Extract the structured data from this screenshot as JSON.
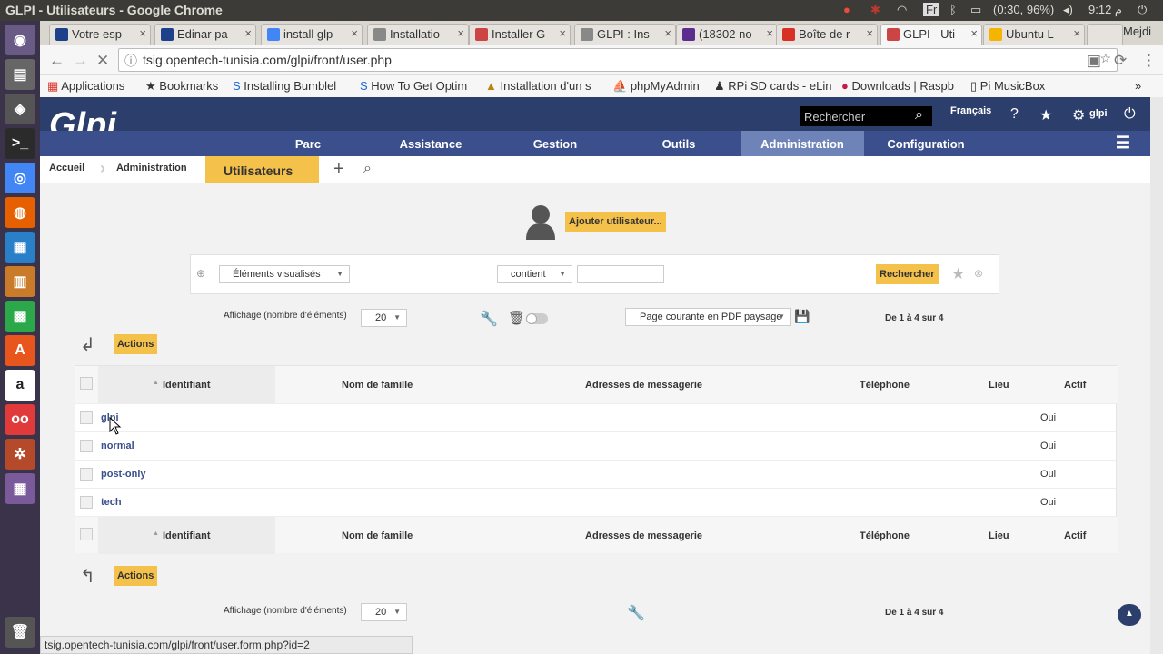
{
  "window": {
    "title": "GLPI - Utilisateurs - Google Chrome",
    "battery": "(0:30, 96%)",
    "lang": "Fr",
    "time": "9:12 م",
    "user": "Mejdi"
  },
  "tabs": [
    {
      "label": "Votre esp",
      "color": "#1e3f8a"
    },
    {
      "label": "Edinar pa",
      "color": "#1e3f8a"
    },
    {
      "label": "install glp",
      "color": "#4285f4"
    },
    {
      "label": "Installatio",
      "color": "#888888"
    },
    {
      "label": "Installer G",
      "color": "#cc4444"
    },
    {
      "label": "GLPI : Ins",
      "color": "#888888"
    },
    {
      "label": "(18302 no",
      "color": "#5b2d8e"
    },
    {
      "label": "Boîte de r",
      "color": "#d93025"
    },
    {
      "label": "GLPI - Uti",
      "color": "#cc4444"
    },
    {
      "label": "Ubuntu L",
      "color": "#f4b400"
    }
  ],
  "url": "tsig.opentech-tunisia.com/glpi/front/user.php",
  "bookmarks": [
    "Applications",
    "Bookmarks",
    "Installing Bumblel",
    "How To Get Optim",
    "Installation d'un s",
    "phpMyAdmin",
    "RPi SD cards - eLin",
    "Downloads | Raspb",
    "Pi MusicBox"
  ],
  "header": {
    "logo": "Glpi",
    "search_placeholder": "Rechercher",
    "language": "Français",
    "user": "glpi"
  },
  "menu": [
    "Parc",
    "Assistance",
    "Gestion",
    "Outils",
    "Administration",
    "Configuration"
  ],
  "breadcrumb": {
    "home": "Accueil",
    "section": "Administration",
    "current": "Utilisateurs"
  },
  "add_user": "Ajouter utilisateur...",
  "search": {
    "field": "Éléments visualisés",
    "operator": "contient",
    "value": "",
    "button": "Rechercher"
  },
  "display": {
    "label": "Affichage (nombre d'éléments)",
    "count": "20",
    "export": "Page courante en PDF paysage",
    "pager": "De 1 à 4 sur 4"
  },
  "actions": "Actions",
  "columns": [
    "Identifiant",
    "Nom de famille",
    "Adresses de messagerie",
    "Téléphone",
    "Lieu",
    "Actif"
  ],
  "rows": [
    {
      "id": "glpi",
      "actif": "Oui"
    },
    {
      "id": "normal",
      "actif": "Oui"
    },
    {
      "id": "post-only",
      "actif": "Oui"
    },
    {
      "id": "tech",
      "actif": "Oui"
    }
  ],
  "status_url": "tsig.opentech-tunisia.com/glpi/front/user.form.php?id=2",
  "colors": {
    "header": "#2c3e6b",
    "menu": "#3a4f8b",
    "accent": "#f4c14a"
  }
}
